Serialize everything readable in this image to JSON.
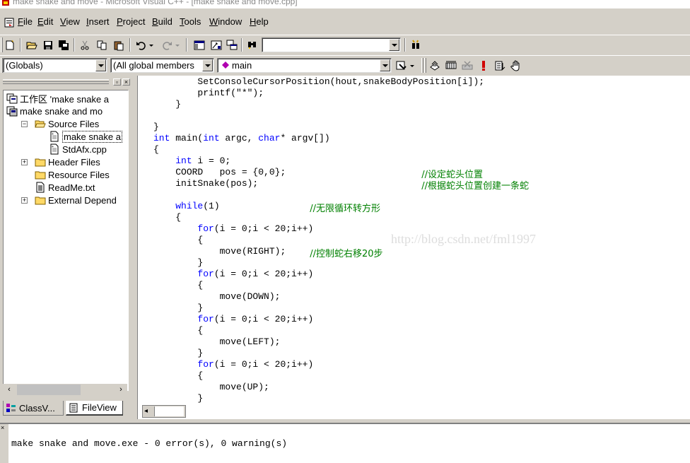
{
  "window": {
    "title": "make snake and move - Microsoft Visual C++ - [make snake and move.cpp]"
  },
  "menu": [
    "File",
    "Edit",
    "View",
    "Insert",
    "Project",
    "Build",
    "Tools",
    "Window",
    "Help"
  ],
  "toolbar": {
    "find_combo_value": "",
    "scope_combo_value": "(Globals)",
    "members_combo_value": "(All global members",
    "function_combo_value": "main"
  },
  "workspace": {
    "tree": [
      {
        "label": "工作区 'make snake a",
        "level": 0,
        "icon": "workspace-icon",
        "expander": ""
      },
      {
        "label": "make snake and mo",
        "level": 0,
        "icon": "project-icon",
        "expander": "−"
      },
      {
        "label": "Source Files",
        "level": 1,
        "icon": "folder-open-icon",
        "expander": "−"
      },
      {
        "label": "make snake a",
        "level": 2,
        "icon": "cpp-file-icon",
        "expander": "",
        "selected": true
      },
      {
        "label": "StdAfx.cpp",
        "level": 2,
        "icon": "cpp-file-icon",
        "expander": ""
      },
      {
        "label": "Header Files",
        "level": 1,
        "icon": "folder-icon",
        "expander": "+"
      },
      {
        "label": "Resource Files",
        "level": 1,
        "icon": "folder-icon",
        "expander": ""
      },
      {
        "label": "ReadMe.txt",
        "level": 1,
        "icon": "text-file-icon",
        "expander": ""
      },
      {
        "label": "External Depend",
        "level": 1,
        "icon": "folder-icon",
        "expander": "+"
      }
    ],
    "tabs": [
      {
        "label": "ClassV...",
        "icon": "classview-icon",
        "active": false
      },
      {
        "label": "FileView",
        "icon": "fileview-icon",
        "active": true
      }
    ]
  },
  "editor": {
    "watermark": "http://blog.csdn.net/fml1997",
    "lines": [
      {
        "indent": 2,
        "segments": [
          {
            "t": "SetConsoleCursorPosition(hout,snakeBodyPosition[i]);",
            "c": "p"
          }
        ]
      },
      {
        "indent": 2,
        "segments": [
          {
            "t": "printf(\"*\");",
            "c": "p"
          }
        ]
      },
      {
        "indent": 1,
        "segments": [
          {
            "t": "}",
            "c": "p"
          }
        ]
      },
      {
        "indent": 0,
        "segments": []
      },
      {
        "indent": 0,
        "segments": [
          {
            "t": "}",
            "c": "p"
          }
        ]
      },
      {
        "indent": 0,
        "segments": [
          {
            "t": "int",
            "c": "kw"
          },
          {
            "t": " main(",
            "c": "p"
          },
          {
            "t": "int",
            "c": "kw"
          },
          {
            "t": " argc, ",
            "c": "p"
          },
          {
            "t": "char",
            "c": "kw"
          },
          {
            "t": "* argv[])",
            "c": "p"
          }
        ]
      },
      {
        "indent": 0,
        "segments": [
          {
            "t": "{",
            "c": "p"
          }
        ]
      },
      {
        "indent": 1,
        "segments": [
          {
            "t": "int",
            "c": "kw"
          },
          {
            "t": " i = 0;",
            "c": "p"
          }
        ]
      },
      {
        "indent": 1,
        "segments": [
          {
            "t": "COORD   pos = {0,0};",
            "c": "p"
          }
        ],
        "comment": "//设定蛇头位置",
        "comment_col": 48
      },
      {
        "indent": 1,
        "segments": [
          {
            "t": "initSnake(pos);",
            "c": "p"
          }
        ],
        "comment": "//根据蛇头位置创建一条蛇",
        "comment_col": 48
      },
      {
        "indent": 0,
        "segments": []
      },
      {
        "indent": 1,
        "segments": [
          {
            "t": "while",
            "c": "kw"
          },
          {
            "t": "(1)",
            "c": "p"
          }
        ],
        "comment": "//无限循环转方形",
        "comment_col": 28
      },
      {
        "indent": 1,
        "segments": [
          {
            "t": "{",
            "c": "p"
          }
        ]
      },
      {
        "indent": 2,
        "segments": [
          {
            "t": "for",
            "c": "kw"
          },
          {
            "t": "(i = 0;i < 20;i++)",
            "c": "p"
          }
        ]
      },
      {
        "indent": 2,
        "segments": [
          {
            "t": "{",
            "c": "p"
          }
        ]
      },
      {
        "indent": 3,
        "segments": [
          {
            "t": "move(RIGHT);",
            "c": "p"
          }
        ],
        "comment": "//控制蛇右移20步",
        "comment_col": 28
      },
      {
        "indent": 2,
        "segments": [
          {
            "t": "}",
            "c": "p"
          }
        ]
      },
      {
        "indent": 2,
        "segments": [
          {
            "t": "for",
            "c": "kw"
          },
          {
            "t": "(i = 0;i < 20;i++)",
            "c": "p"
          }
        ]
      },
      {
        "indent": 2,
        "segments": [
          {
            "t": "{",
            "c": "p"
          }
        ]
      },
      {
        "indent": 3,
        "segments": [
          {
            "t": "move(DOWN);",
            "c": "p"
          }
        ]
      },
      {
        "indent": 2,
        "segments": [
          {
            "t": "}",
            "c": "p"
          }
        ]
      },
      {
        "indent": 2,
        "segments": [
          {
            "t": "for",
            "c": "kw"
          },
          {
            "t": "(i = 0;i < 20;i++)",
            "c": "p"
          }
        ]
      },
      {
        "indent": 2,
        "segments": [
          {
            "t": "{",
            "c": "p"
          }
        ]
      },
      {
        "indent": 3,
        "segments": [
          {
            "t": "move(LEFT);",
            "c": "p"
          }
        ]
      },
      {
        "indent": 2,
        "segments": [
          {
            "t": "}",
            "c": "p"
          }
        ]
      },
      {
        "indent": 2,
        "segments": [
          {
            "t": "for",
            "c": "kw"
          },
          {
            "t": "(i = 0;i < 20;i++)",
            "c": "p"
          }
        ]
      },
      {
        "indent": 2,
        "segments": [
          {
            "t": "{",
            "c": "p"
          }
        ]
      },
      {
        "indent": 3,
        "segments": [
          {
            "t": "move(UP);",
            "c": "p"
          }
        ]
      },
      {
        "indent": 2,
        "segments": [
          {
            "t": "}",
            "c": "p"
          }
        ]
      }
    ]
  },
  "output": {
    "text": "make snake and move.exe - 0 error(s), 0 warning(s)"
  },
  "colors": {
    "keyword": "#0000ff",
    "comment": "#008000",
    "chrome": "#d4d0c8"
  }
}
